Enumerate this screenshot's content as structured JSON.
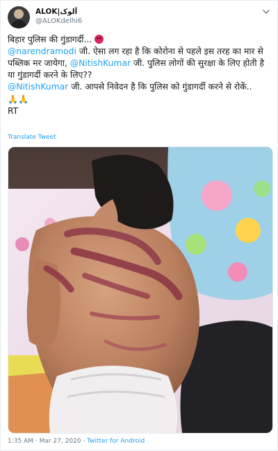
{
  "author": {
    "display_name": "ALOK|آلوک",
    "handle": "@ALOKdelhi6"
  },
  "tweet": {
    "line1": "बिहार पुलिस की गुंडागर्दी...",
    "mention1": "@narendramodi",
    "text2": " जी. ऐसा लग रहा है कि कोरोना से पहले इस तरह का मार से पब्लिक मर जायेगा, ",
    "mention2": "@NitishKumar",
    "text3": " जी. पुलिस लोगों की सुरक्षा के लिए होती है या गुंडागर्दी करने के लिए??",
    "mention3": "@NitishKumar",
    "text4": " जी. आपसे निवेदन है कि पुलिस को गुंडागर्दी करने से रोकें.. ",
    "rt": "RT"
  },
  "translate_label": "Translate Tweet",
  "footer": {
    "time": "1:35 AM",
    "separator1": " · ",
    "date": "Mar 27, 2020",
    "separator2": " · ",
    "source": "Twitter for Android"
  },
  "colors": {
    "link": "#1da1f2",
    "muted": "#657786"
  },
  "icons": {
    "menu": "chevron-down-icon",
    "emoji1": "angry-face-emoji",
    "emoji2": "folded-hands-emoji"
  }
}
